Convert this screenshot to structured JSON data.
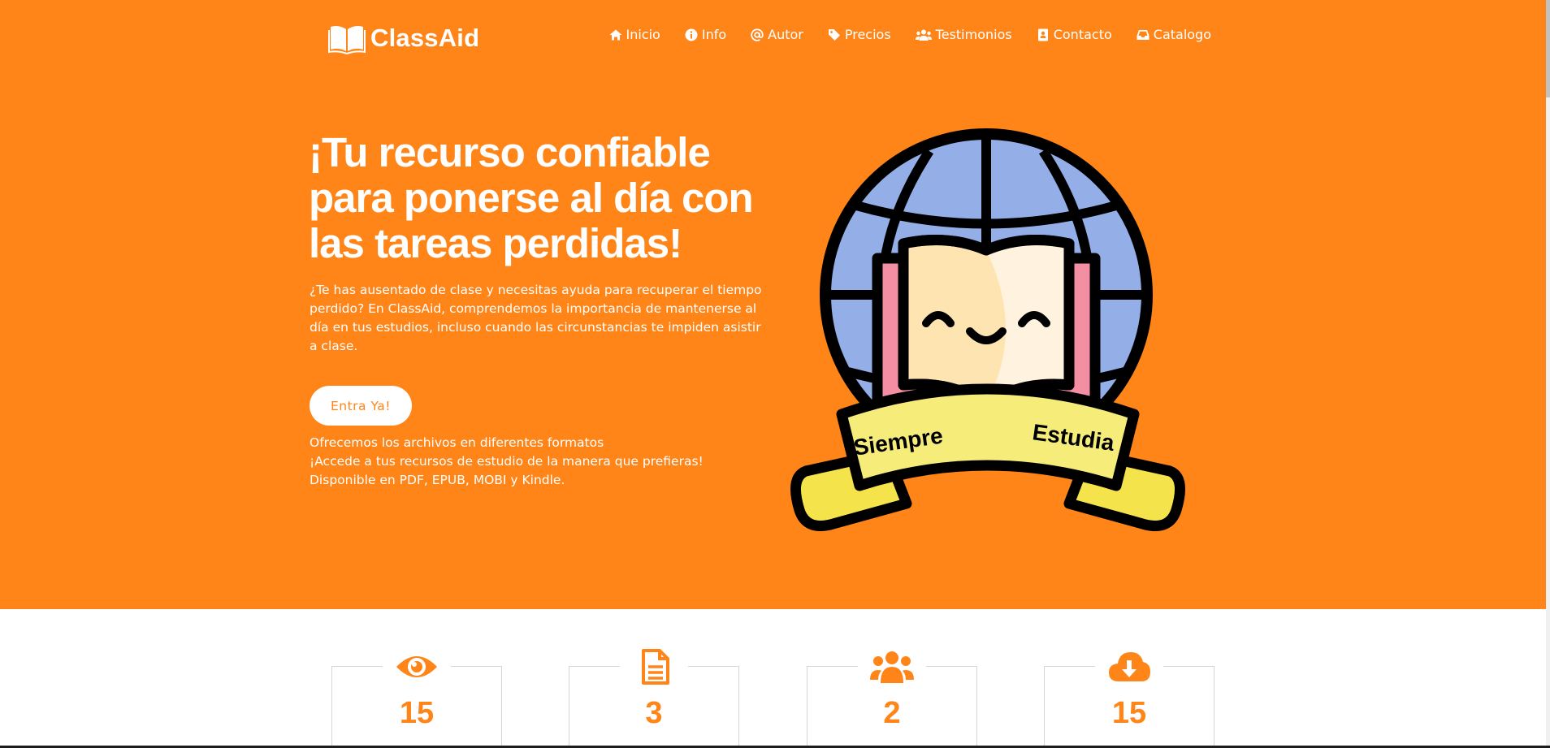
{
  "brand": {
    "name": "ClassAid",
    "icon": "open-book-icon"
  },
  "nav": {
    "items": [
      {
        "label": "Inicio",
        "icon": "home-icon"
      },
      {
        "label": "Info",
        "icon": "info-circle-icon"
      },
      {
        "label": "Autor",
        "icon": "at-sign-icon"
      },
      {
        "label": "Precios",
        "icon": "tag-icon"
      },
      {
        "label": "Testimonios",
        "icon": "users-icon"
      },
      {
        "label": "Contacto",
        "icon": "contact-card-icon"
      },
      {
        "label": "Catalogo",
        "icon": "inbox-icon"
      }
    ]
  },
  "hero": {
    "title": "¡Tu recurso confiable para ponerse al día con las tareas perdidas!",
    "intro": "¿Te has ausentado de clase y necesitas ayuda para recuperar el tiempo perdido? En ClassAid, comprendemos la importancia de mantenerse al día en tus estudios, incluso cuando las circunstancias te impiden asistir a clase.",
    "cta_label": "Entra Ya!",
    "formats_lines": [
      "Ofrecemos los archivos en diferentes formatos",
      "¡Accede a tus recursos de estudio de la manera que prefieras!",
      "Disponible en PDF, EPUB, MOBI y Kindle."
    ],
    "illustration": {
      "icon": "globe-book-badge-icon",
      "ribbon_left": "Siempre",
      "ribbon_right": "Estudia"
    }
  },
  "stats": [
    {
      "icon": "eye-icon",
      "value": "15"
    },
    {
      "icon": "document-icon",
      "value": "3"
    },
    {
      "icon": "users-group-icon",
      "value": "2"
    },
    {
      "icon": "cloud-download-icon",
      "value": "15"
    }
  ],
  "colors": {
    "primary": "#ff8519",
    "text_light": "#ffffff",
    "card_border": "#d6d6d6"
  }
}
